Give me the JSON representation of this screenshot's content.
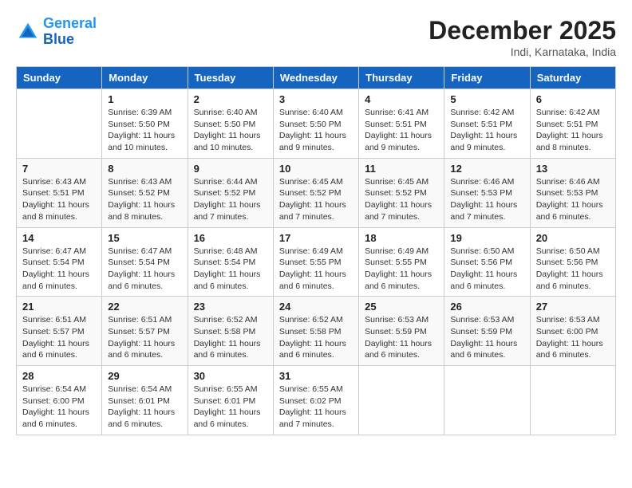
{
  "header": {
    "logo_line1": "General",
    "logo_line2": "Blue",
    "month": "December 2025",
    "location": "Indi, Karnataka, India"
  },
  "weekdays": [
    "Sunday",
    "Monday",
    "Tuesday",
    "Wednesday",
    "Thursday",
    "Friday",
    "Saturday"
  ],
  "weeks": [
    [
      {
        "day": "",
        "info": ""
      },
      {
        "day": "1",
        "info": "Sunrise: 6:39 AM\nSunset: 5:50 PM\nDaylight: 11 hours\nand 10 minutes."
      },
      {
        "day": "2",
        "info": "Sunrise: 6:40 AM\nSunset: 5:50 PM\nDaylight: 11 hours\nand 10 minutes."
      },
      {
        "day": "3",
        "info": "Sunrise: 6:40 AM\nSunset: 5:50 PM\nDaylight: 11 hours\nand 9 minutes."
      },
      {
        "day": "4",
        "info": "Sunrise: 6:41 AM\nSunset: 5:51 PM\nDaylight: 11 hours\nand 9 minutes."
      },
      {
        "day": "5",
        "info": "Sunrise: 6:42 AM\nSunset: 5:51 PM\nDaylight: 11 hours\nand 9 minutes."
      },
      {
        "day": "6",
        "info": "Sunrise: 6:42 AM\nSunset: 5:51 PM\nDaylight: 11 hours\nand 8 minutes."
      }
    ],
    [
      {
        "day": "7",
        "info": "Sunrise: 6:43 AM\nSunset: 5:51 PM\nDaylight: 11 hours\nand 8 minutes."
      },
      {
        "day": "8",
        "info": "Sunrise: 6:43 AM\nSunset: 5:52 PM\nDaylight: 11 hours\nand 8 minutes."
      },
      {
        "day": "9",
        "info": "Sunrise: 6:44 AM\nSunset: 5:52 PM\nDaylight: 11 hours\nand 7 minutes."
      },
      {
        "day": "10",
        "info": "Sunrise: 6:45 AM\nSunset: 5:52 PM\nDaylight: 11 hours\nand 7 minutes."
      },
      {
        "day": "11",
        "info": "Sunrise: 6:45 AM\nSunset: 5:52 PM\nDaylight: 11 hours\nand 7 minutes."
      },
      {
        "day": "12",
        "info": "Sunrise: 6:46 AM\nSunset: 5:53 PM\nDaylight: 11 hours\nand 7 minutes."
      },
      {
        "day": "13",
        "info": "Sunrise: 6:46 AM\nSunset: 5:53 PM\nDaylight: 11 hours\nand 6 minutes."
      }
    ],
    [
      {
        "day": "14",
        "info": "Sunrise: 6:47 AM\nSunset: 5:54 PM\nDaylight: 11 hours\nand 6 minutes."
      },
      {
        "day": "15",
        "info": "Sunrise: 6:47 AM\nSunset: 5:54 PM\nDaylight: 11 hours\nand 6 minutes."
      },
      {
        "day": "16",
        "info": "Sunrise: 6:48 AM\nSunset: 5:54 PM\nDaylight: 11 hours\nand 6 minutes."
      },
      {
        "day": "17",
        "info": "Sunrise: 6:49 AM\nSunset: 5:55 PM\nDaylight: 11 hours\nand 6 minutes."
      },
      {
        "day": "18",
        "info": "Sunrise: 6:49 AM\nSunset: 5:55 PM\nDaylight: 11 hours\nand 6 minutes."
      },
      {
        "day": "19",
        "info": "Sunrise: 6:50 AM\nSunset: 5:56 PM\nDaylight: 11 hours\nand 6 minutes."
      },
      {
        "day": "20",
        "info": "Sunrise: 6:50 AM\nSunset: 5:56 PM\nDaylight: 11 hours\nand 6 minutes."
      }
    ],
    [
      {
        "day": "21",
        "info": "Sunrise: 6:51 AM\nSunset: 5:57 PM\nDaylight: 11 hours\nand 6 minutes."
      },
      {
        "day": "22",
        "info": "Sunrise: 6:51 AM\nSunset: 5:57 PM\nDaylight: 11 hours\nand 6 minutes."
      },
      {
        "day": "23",
        "info": "Sunrise: 6:52 AM\nSunset: 5:58 PM\nDaylight: 11 hours\nand 6 minutes."
      },
      {
        "day": "24",
        "info": "Sunrise: 6:52 AM\nSunset: 5:58 PM\nDaylight: 11 hours\nand 6 minutes."
      },
      {
        "day": "25",
        "info": "Sunrise: 6:53 AM\nSunset: 5:59 PM\nDaylight: 11 hours\nand 6 minutes."
      },
      {
        "day": "26",
        "info": "Sunrise: 6:53 AM\nSunset: 5:59 PM\nDaylight: 11 hours\nand 6 minutes."
      },
      {
        "day": "27",
        "info": "Sunrise: 6:53 AM\nSunset: 6:00 PM\nDaylight: 11 hours\nand 6 minutes."
      }
    ],
    [
      {
        "day": "28",
        "info": "Sunrise: 6:54 AM\nSunset: 6:00 PM\nDaylight: 11 hours\nand 6 minutes."
      },
      {
        "day": "29",
        "info": "Sunrise: 6:54 AM\nSunset: 6:01 PM\nDaylight: 11 hours\nand 6 minutes."
      },
      {
        "day": "30",
        "info": "Sunrise: 6:55 AM\nSunset: 6:01 PM\nDaylight: 11 hours\nand 6 minutes."
      },
      {
        "day": "31",
        "info": "Sunrise: 6:55 AM\nSunset: 6:02 PM\nDaylight: 11 hours\nand 7 minutes."
      },
      {
        "day": "",
        "info": ""
      },
      {
        "day": "",
        "info": ""
      },
      {
        "day": "",
        "info": ""
      }
    ]
  ]
}
